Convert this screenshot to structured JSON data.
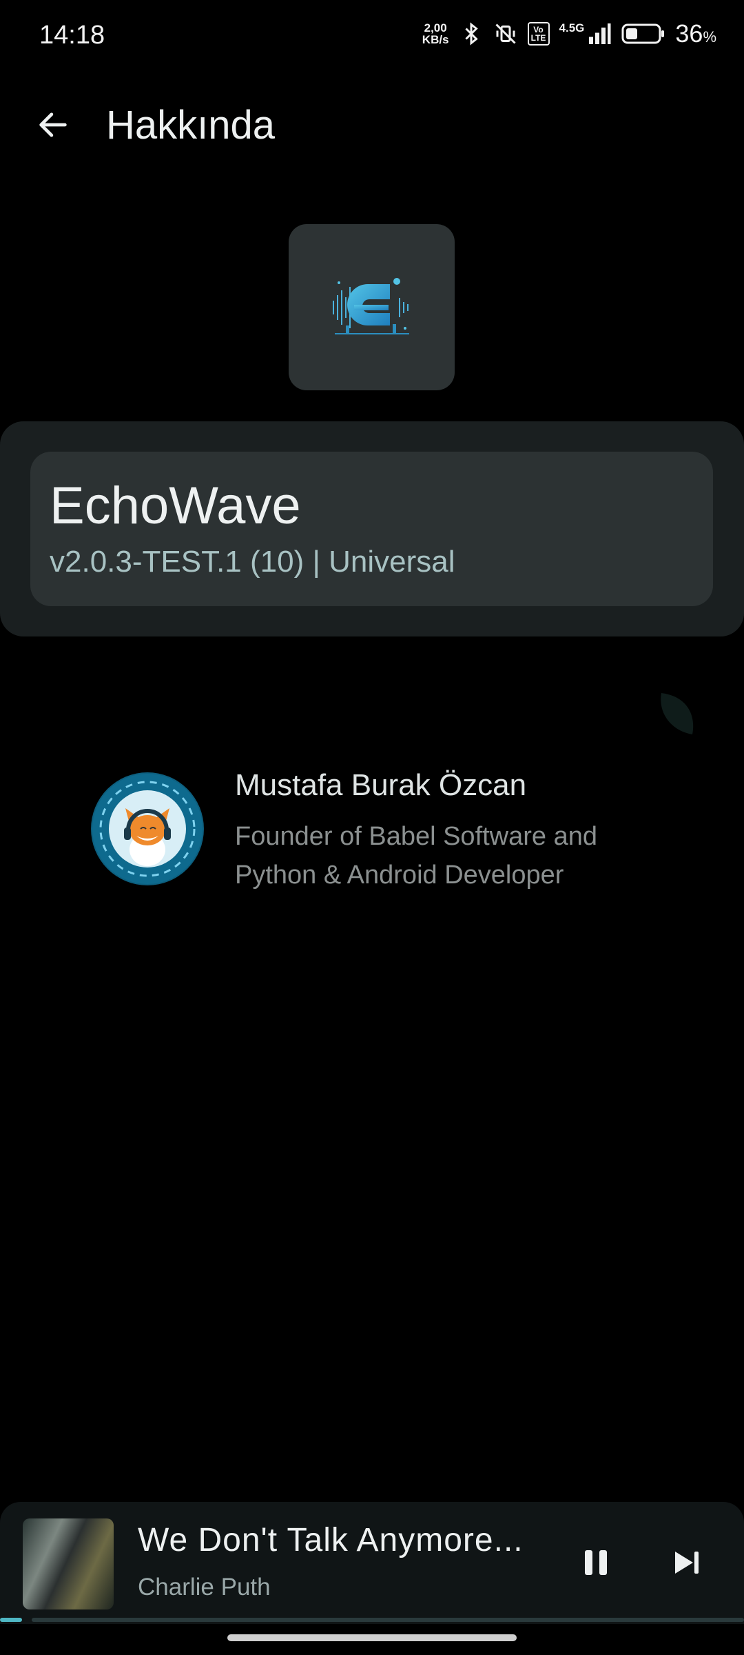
{
  "status_bar": {
    "time": "14:18",
    "net_speed_value": "2,00",
    "net_speed_unit": "KB/s",
    "volte_label": "Vo LTE",
    "network_type": "4.5G",
    "battery_percent": "36",
    "battery_percent_sign": "%",
    "battery_level": 0.36
  },
  "app_bar": {
    "title": "Hakkında"
  },
  "app_info": {
    "name": "EchoWave",
    "version": "v2.0.3-TEST.1 (10) | Universal"
  },
  "developer": {
    "name": "Mustafa Burak Özcan",
    "description": "Founder of Babel Software and Python & Android Developer"
  },
  "mini_player": {
    "title": "We Don't Talk Anymore...",
    "artist": "Charlie Puth",
    "progress": 0.03
  },
  "colors": {
    "accent": "#4fb7c4",
    "background": "#000000",
    "card": "#2c3233"
  }
}
